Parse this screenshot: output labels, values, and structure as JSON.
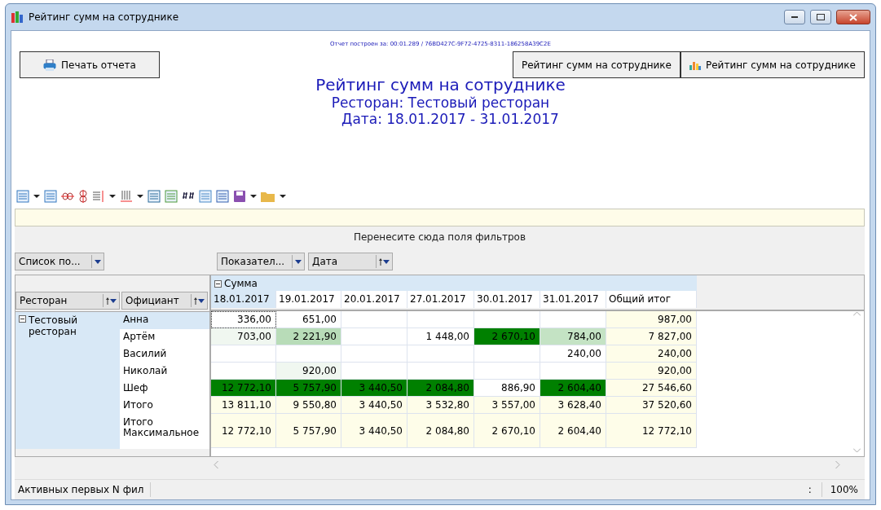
{
  "window": {
    "title": "Рейтинг сумм на сотруднике"
  },
  "report": {
    "build_info": "Отчет построен за: 00:01.289 / 76BD427C-9F72-4725-8311-186258A39C2E",
    "print_button": "Печать отчета",
    "buttons": [
      {
        "label": "Рейтинг сумм на сотруднике",
        "kind": "plain"
      },
      {
        "label": "Рейтинг сумм на сотруднике",
        "kind": "chart"
      }
    ],
    "title": "Рейтинг сумм на сотруднике",
    "restaurant": "Ресторан: Тестовый ресторан",
    "date": "Дата: 18.01.2017 - 31.01.2017"
  },
  "filter_area": {
    "placeholder": "Перенесите сюда поля фильтров"
  },
  "data_field": "Список по...",
  "column_fields": [
    {
      "label": "Показател...",
      "sortable": false
    },
    {
      "label": "Дата",
      "sortable": true
    }
  ],
  "row_fields": [
    {
      "label": "Ресторан",
      "sortable": true
    },
    {
      "label": "Официант",
      "sortable": true
    }
  ],
  "pivot": {
    "measure": "Сумма",
    "measure_expanded": true,
    "columns": [
      {
        "label": "18.01.2017",
        "selected": true
      },
      {
        "label": "19.01.2017",
        "selected": false
      },
      {
        "label": "20.01.2017",
        "selected": false
      },
      {
        "label": "27.01.2017",
        "selected": false
      },
      {
        "label": "30.01.2017",
        "selected": false
      },
      {
        "label": "31.01.2017",
        "selected": false
      }
    ],
    "total_column": "Общий итог",
    "group": "Тестовый ресторан",
    "group_expanded": true,
    "rows": [
      {
        "label": "Анна",
        "selected": true,
        "tall": false,
        "cells": [
          {
            "value": "336,00",
            "color": "#ffffff",
            "focused": true
          },
          {
            "value": "651,00",
            "color": "#ffffff",
            "focused": false
          },
          {
            "color": "#ffffff",
            "focused": false
          },
          {
            "color": "#ffffff",
            "focused": false
          },
          {
            "color": "#ffffff",
            "focused": false
          },
          {
            "color": "#ffffff",
            "focused": false
          },
          {
            "value": "987,00",
            "color": "#fefde9",
            "focused": false
          }
        ]
      },
      {
        "label": "Артём",
        "selected": false,
        "tall": false,
        "cells": [
          {
            "value": "703,00",
            "color": "#f0f7f0",
            "focused": false
          },
          {
            "value": "2 221,90",
            "color": "#b8dcb8",
            "focused": false
          },
          {
            "color": "#ffffff",
            "focused": false
          },
          {
            "value": "1 448,00",
            "color": "#ffffff",
            "focused": false
          },
          {
            "value": "2 670,10",
            "color": "#008000",
            "focused": false
          },
          {
            "value": "784,00",
            "color": "#c4e3c4",
            "focused": false
          },
          {
            "value": "7 827,00",
            "color": "#fefde9",
            "focused": false
          }
        ]
      },
      {
        "label": "Василий",
        "selected": false,
        "tall": false,
        "cells": [
          {
            "color": "#ffffff",
            "focused": false
          },
          {
            "color": "#ffffff",
            "focused": false
          },
          {
            "color": "#ffffff",
            "focused": false
          },
          {
            "color": "#ffffff",
            "focused": false
          },
          {
            "color": "#ffffff",
            "focused": false
          },
          {
            "value": "240,00",
            "color": "#ffffff",
            "focused": false
          },
          {
            "value": "240,00",
            "color": "#fefde9",
            "focused": false
          }
        ]
      },
      {
        "label": "Николай",
        "selected": false,
        "tall": false,
        "cells": [
          {
            "color": "#ffffff",
            "focused": false
          },
          {
            "value": "920,00",
            "color": "#f0f7f0",
            "focused": false
          },
          {
            "color": "#ffffff",
            "focused": false
          },
          {
            "color": "#ffffff",
            "focused": false
          },
          {
            "color": "#ffffff",
            "focused": false
          },
          {
            "color": "#ffffff",
            "focused": false
          },
          {
            "value": "920,00",
            "color": "#fefde9",
            "focused": false
          }
        ]
      },
      {
        "label": "Шеф",
        "selected": false,
        "tall": false,
        "cells": [
          {
            "value": "12 772,10",
            "color": "#008000",
            "focused": false
          },
          {
            "value": "5 757,90",
            "color": "#008000",
            "focused": false
          },
          {
            "value": "3 440,50",
            "color": "#008000",
            "focused": false
          },
          {
            "value": "2 084,80",
            "color": "#008000",
            "focused": false
          },
          {
            "value": "886,90",
            "color": "#ffffff",
            "focused": false
          },
          {
            "value": "2 604,40",
            "color": "#008000",
            "focused": false
          },
          {
            "value": "27 546,60",
            "color": "#fefde9",
            "focused": false
          }
        ]
      },
      {
        "label": "Итого",
        "selected": false,
        "tall": false,
        "cells": [
          {
            "value": "13 811,10",
            "color": "#fefde9",
            "focused": false
          },
          {
            "value": "9 550,80",
            "color": "#fefde9",
            "focused": false
          },
          {
            "value": "3 440,50",
            "color": "#fefde9",
            "focused": false
          },
          {
            "value": "3 532,80",
            "color": "#fefde9",
            "focused": false
          },
          {
            "value": "3 557,00",
            "color": "#fefde9",
            "focused": false
          },
          {
            "value": "3 628,40",
            "color": "#fefde9",
            "focused": false
          },
          {
            "value": "37 520,60",
            "color": "#fefde9",
            "focused": false
          }
        ]
      },
      {
        "label": "Итого Максимальное",
        "selected": false,
        "tall": true,
        "cells": [
          {
            "value": "12 772,10",
            "color": "#fefde9",
            "focused": false
          },
          {
            "value": "5 757,90",
            "color": "#fefde9",
            "focused": false
          },
          {
            "value": "3 440,50",
            "color": "#fefde9",
            "focused": false
          },
          {
            "value": "2 084,80",
            "color": "#fefde9",
            "focused": false
          },
          {
            "value": "2 670,10",
            "color": "#fefde9",
            "focused": false
          },
          {
            "value": "2 604,40",
            "color": "#fefde9",
            "focused": false
          },
          {
            "value": "12 772,10",
            "color": "#fefde9",
            "focused": false
          }
        ]
      }
    ]
  },
  "status_bar": {
    "filter_info": "Активных первых N фил",
    "separator": ":",
    "zoom": "100%"
  }
}
